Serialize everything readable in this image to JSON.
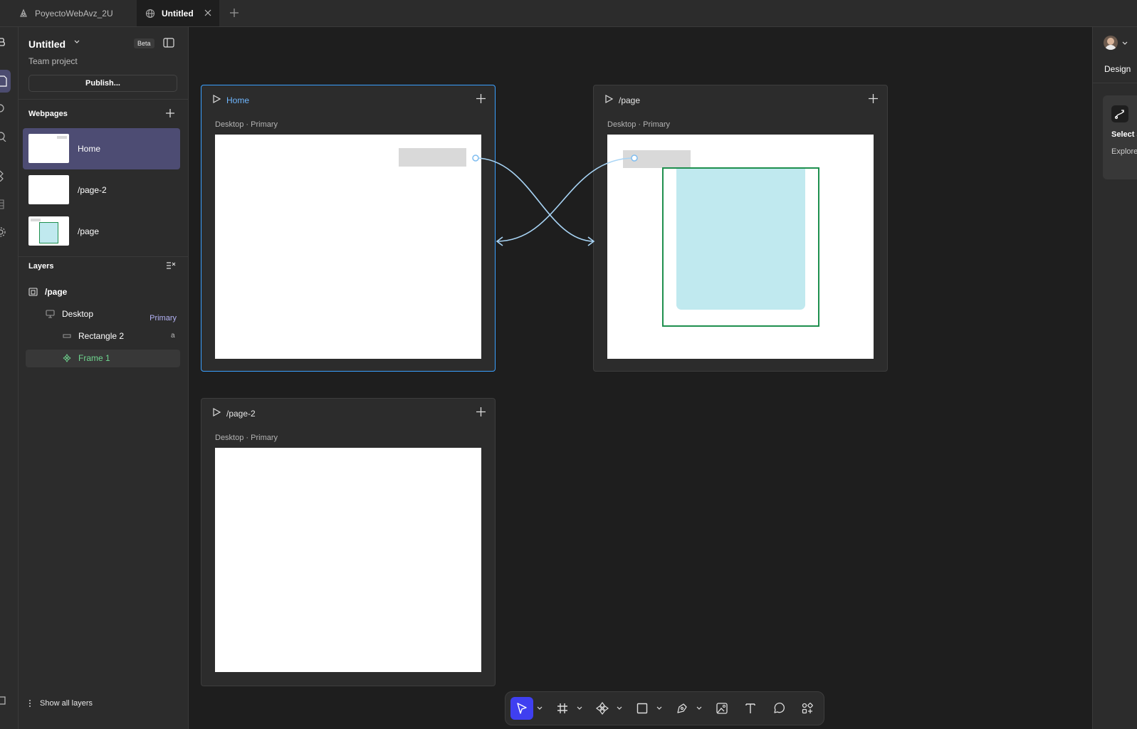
{
  "tabs": [
    {
      "label": "PoyectoWebAvz_2U",
      "icon": "figma-sites-icon"
    },
    {
      "label": "Untitled",
      "icon": "globe-icon"
    }
  ],
  "project": {
    "title": "Untitled",
    "beta": "Beta",
    "team": "Team project",
    "publish": "Publish..."
  },
  "webpages": {
    "title": "Webpages",
    "items": [
      {
        "label": "Home"
      },
      {
        "label": "/page-2"
      },
      {
        "label": "/page"
      }
    ]
  },
  "layers": {
    "title": "Layers",
    "items": [
      {
        "label": "/page"
      },
      {
        "label": "Desktop",
        "badge": "Primary"
      },
      {
        "label": "Rectangle 2",
        "shortcut": "a"
      },
      {
        "label": "Frame 1"
      }
    ],
    "show_all": "Show all layers"
  },
  "canvas": {
    "cards": [
      {
        "title": "Home",
        "sub": "Desktop · Primary"
      },
      {
        "title": "/page",
        "sub": "Desktop · Primary"
      },
      {
        "title": "/page-2",
        "sub": "Desktop · Primary"
      }
    ]
  },
  "right_panel": {
    "tab": "Design",
    "tip_title": "Select a",
    "tip_body": "Explore more."
  },
  "colors": {
    "accent": "#3f3ff0",
    "selection": "#3aa0ff",
    "frame_green": "#1e8f4e",
    "rect_cyan": "#c0e9ef",
    "connector": "#a8d4f5"
  }
}
